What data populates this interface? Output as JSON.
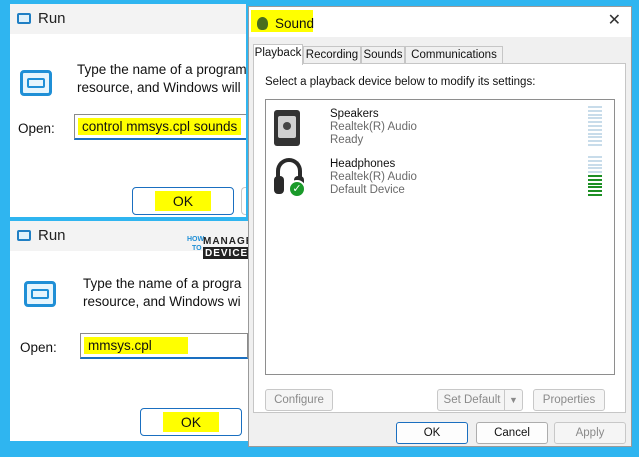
{
  "run_top": {
    "title": "Run",
    "description_line1": "Type the name of a program",
    "description_line2": "resource, and Windows will",
    "open_label": "Open:",
    "open_value": "control mmsys.cpl sounds",
    "ok_label": "OK"
  },
  "run_bottom": {
    "title": "Run",
    "description_line1": "Type the name of a progra",
    "description_line2": "resource, and Windows wi",
    "open_label": "Open:",
    "open_value": "mmsys.cpl",
    "ok_label": "OK"
  },
  "watermark": {
    "how": "HOW",
    "to": "TO",
    "manage": "MANAGE",
    "devices": "DEVICES"
  },
  "sound": {
    "title": "Sound",
    "tabs": [
      {
        "label": "Playback",
        "active": true
      },
      {
        "label": "Recording",
        "active": false
      },
      {
        "label": "Sounds",
        "active": false
      },
      {
        "label": "Communications",
        "active": false
      }
    ],
    "instruction": "Select a playback device below to modify its settings:",
    "devices": [
      {
        "name": "Speakers",
        "driver": "Realtek(R) Audio",
        "status": "Ready",
        "icon": "speaker-icon",
        "level_bars_on": 0,
        "level_bars_total": 11
      },
      {
        "name": "Headphones",
        "driver": "Realtek(R) Audio",
        "status": "Default Device",
        "icon": "headphones-icon",
        "default": true,
        "level_bars_on": 6,
        "level_bars_total": 11
      }
    ],
    "configure_label": "Configure",
    "set_default_label": "Set Default",
    "properties_label": "Properties",
    "ok_label": "OK",
    "cancel_label": "Cancel",
    "apply_label": "Apply"
  },
  "colors": {
    "background": "#2fb5f0",
    "highlight": "#ffff00",
    "accent": "#1a6fc0",
    "level_on": "#1d8f24",
    "level_off": "#c8dcea"
  }
}
